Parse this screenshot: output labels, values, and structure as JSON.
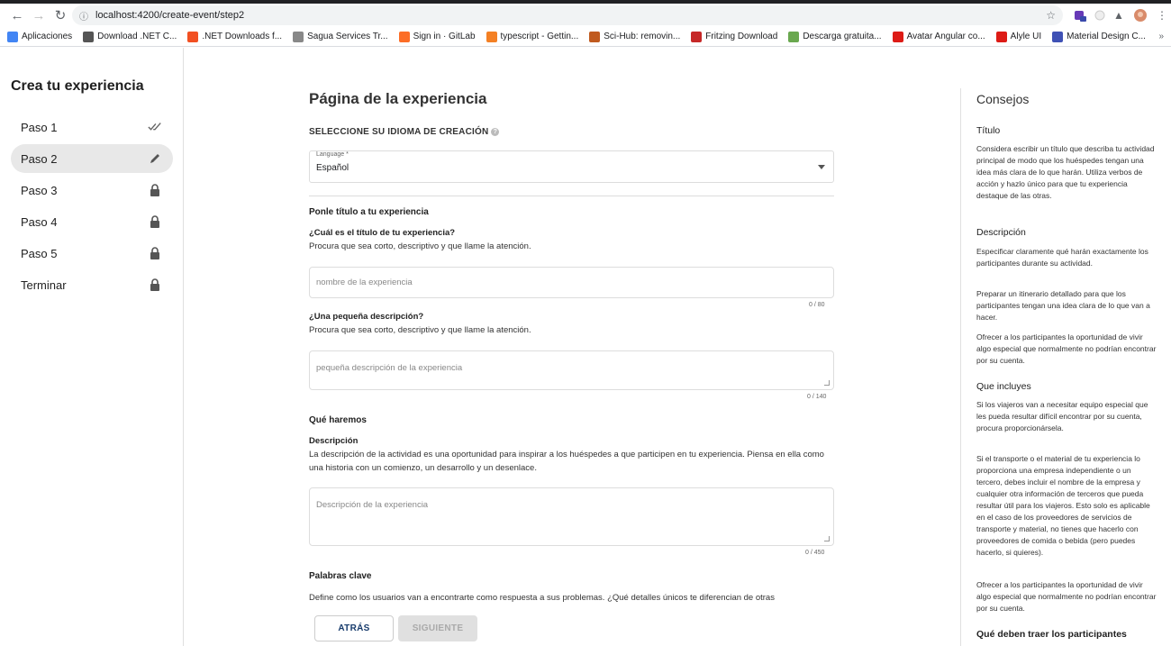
{
  "browser": {
    "url": "localhost:4200/create-event/step2",
    "bookmarks": [
      {
        "label": "Aplicaciones",
        "color": "#4285f4"
      },
      {
        "label": "Download .NET C...",
        "color": "#555555"
      },
      {
        "label": ".NET Downloads f...",
        "color": "#f25022"
      },
      {
        "label": "Sagua Services Tr...",
        "color": "#888888"
      },
      {
        "label": "Sign in · GitLab",
        "color": "#fc6d26"
      },
      {
        "label": "typescript - Gettin...",
        "color": "#f48024"
      },
      {
        "label": "Sci-Hub: removin...",
        "color": "#c05a1f"
      },
      {
        "label": "Fritzing Download",
        "color": "#c62828"
      },
      {
        "label": "Descarga gratuita...",
        "color": "#6aa84f"
      },
      {
        "label": "Avatar Angular co...",
        "color": "#dd1b16"
      },
      {
        "label": "Alyle UI",
        "color": "#dd1b16"
      },
      {
        "label": "Material Design C...",
        "color": "#3f51b5"
      }
    ],
    "more_bookmarks": "»"
  },
  "sidebar": {
    "title": "Crea tu experiencia",
    "steps": [
      {
        "label": "Paso 1",
        "icon": "double-check-icon",
        "state": "done"
      },
      {
        "label": "Paso 2",
        "icon": "pencil-icon",
        "state": "active"
      },
      {
        "label": "Paso 3",
        "icon": "lock-icon",
        "state": "locked"
      },
      {
        "label": "Paso 4",
        "icon": "lock-icon",
        "state": "locked"
      },
      {
        "label": "Paso 5",
        "icon": "lock-icon",
        "state": "locked"
      },
      {
        "label": "Terminar",
        "icon": "lock-icon",
        "state": "locked"
      }
    ]
  },
  "main": {
    "title": "Página de la experiencia",
    "language_section_label": "SELECCIONE SU IDIOMA DE CREACIÓN",
    "language_select": {
      "floating_label": "Language *",
      "value": "Español"
    },
    "title_section": {
      "heading": "Ponle título a tu experiencia",
      "question": "¿Cuál es el título de tu experiencia?",
      "hint": "Procura que sea corto, descriptivo y que llame la atención.",
      "placeholder": "nombre de la experiencia",
      "counter": "0 / 80"
    },
    "short_desc_section": {
      "question": "¿Una pequeña descripción?",
      "hint": "Procura que sea corto, descriptivo y que llame la atención.",
      "placeholder": "pequeña descripción de la experiencia",
      "counter": "0 / 140"
    },
    "what_section": {
      "heading": "Qué haremos",
      "sub": "Descripción",
      "hint": "La descripción de la actividad es una oportunidad para inspirar a los huéspedes a que participen en tu experiencia. Piensa en ella como una historia con un comienzo, un desarrollo y un desenlace.",
      "placeholder": "Descripción de la experiencia",
      "counter": "0 / 450"
    },
    "keywords_section": {
      "heading": "Palabras clave",
      "hint": "Define como los usuarios van a encontrarte como respuesta a sus problemas. ¿Qué detalles únicos te diferencian de otras"
    },
    "buttons": {
      "back": "ATRÁS",
      "next": "SIGUIENTE"
    }
  },
  "tips": {
    "title": "Consejos",
    "sections": [
      {
        "heading": "Título",
        "bold": false,
        "paragraphs": [
          "Considera escribir un título que describa tu actividad principal de modo que los huéspedes tengan una idea más clara de lo que harán. Utiliza verbos de acción y hazlo único para que tu experiencia destaque de las otras."
        ]
      },
      {
        "heading": "Descripción",
        "bold": false,
        "paragraphs": [
          "Especificar claramente qué harán exactamente los participantes durante su actividad.",
          "Preparar un itinerario detallado para que los participantes tengan una idea clara de lo que van a hacer.",
          "Ofrecer a los participantes la oportunidad de vivir algo especial que normalmente no podrían encontrar por su cuenta."
        ]
      },
      {
        "heading": "Que incluyes",
        "bold": false,
        "paragraphs": [
          "Si los viajeros van a necesitar equipo especial que les pueda resultar difícil encontrar por su cuenta, procura proporcionársela.",
          "Si el transporte o el material de tu experiencia lo proporciona una empresa independiente o un tercero, debes incluir el nombre de la empresa y cualquier otra información de terceros que pueda resultar útil para los viajeros. Esto solo es aplicable en el caso de los proveedores de servicios de transporte y material, no tienes que hacerlo con proveedores de comida o bebida (pero puedes hacerlo, si quieres).",
          "Ofrecer a los participantes la oportunidad de vivir algo especial que normalmente no podrían encontrar por su cuenta."
        ]
      },
      {
        "heading": "Qué deben traer los participantes",
        "bold": true,
        "paragraphs": []
      }
    ]
  }
}
